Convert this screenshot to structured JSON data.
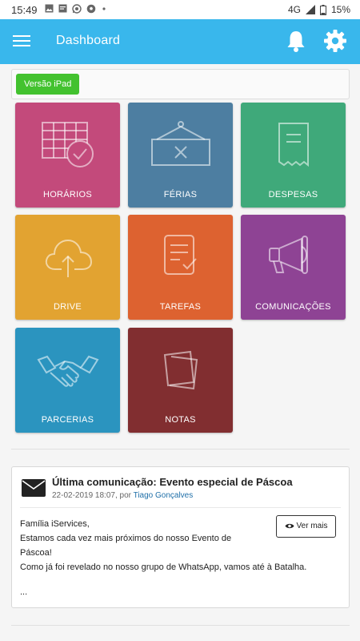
{
  "status_bar": {
    "time": "15:49",
    "network": "4G",
    "battery": "15%",
    "notification_icons": [
      "image-icon",
      "message-icon",
      "whatsapp-icon",
      "soccer-ball-icon",
      "dot-icon"
    ]
  },
  "app_bar": {
    "title": "Dashboard",
    "color": "#39b7ec",
    "icons": [
      "menu-icon",
      "bell-icon",
      "gear-icon"
    ]
  },
  "ipad_button": {
    "label": "Versão iPad",
    "color": "#43c22f"
  },
  "tiles": [
    {
      "label": "HORÁRIOS",
      "color": "#c34a7b",
      "icon": "schedule-table-icon"
    },
    {
      "label": "FÉRIAS",
      "color": "#4d7ea1",
      "icon": "closed-sign-icon"
    },
    {
      "label": "DESPESAS",
      "color": "#3fa97a",
      "icon": "receipt-icon"
    },
    {
      "label": "DRIVE",
      "color": "#e2a331",
      "icon": "cloud-upload-icon"
    },
    {
      "label": "TAREFAS",
      "color": "#dd6230",
      "icon": "task-list-icon"
    },
    {
      "label": "COMUNICAÇÕES",
      "color": "#8e4394",
      "icon": "megaphone-icon"
    },
    {
      "label": "PARCERIAS",
      "color": "#2b94bf",
      "icon": "handshake-icon"
    },
    {
      "label": "NOTAS",
      "color": "#812e30",
      "icon": "notes-icon"
    }
  ],
  "communication": {
    "title": "Última comunicação: Evento especial de Páscoa",
    "date": "22-02-2019 18:07, por",
    "author": "Tiago Gonçalves",
    "lines": [
      "Família iServices,",
      "Estamos cada vez mais próximos do nosso Evento de",
      "Páscoa!",
      "Como já foi revelado no nosso grupo de WhatsApp, vamos até à Batalha."
    ],
    "ellipsis": "...",
    "button_label": "Ver mais"
  }
}
